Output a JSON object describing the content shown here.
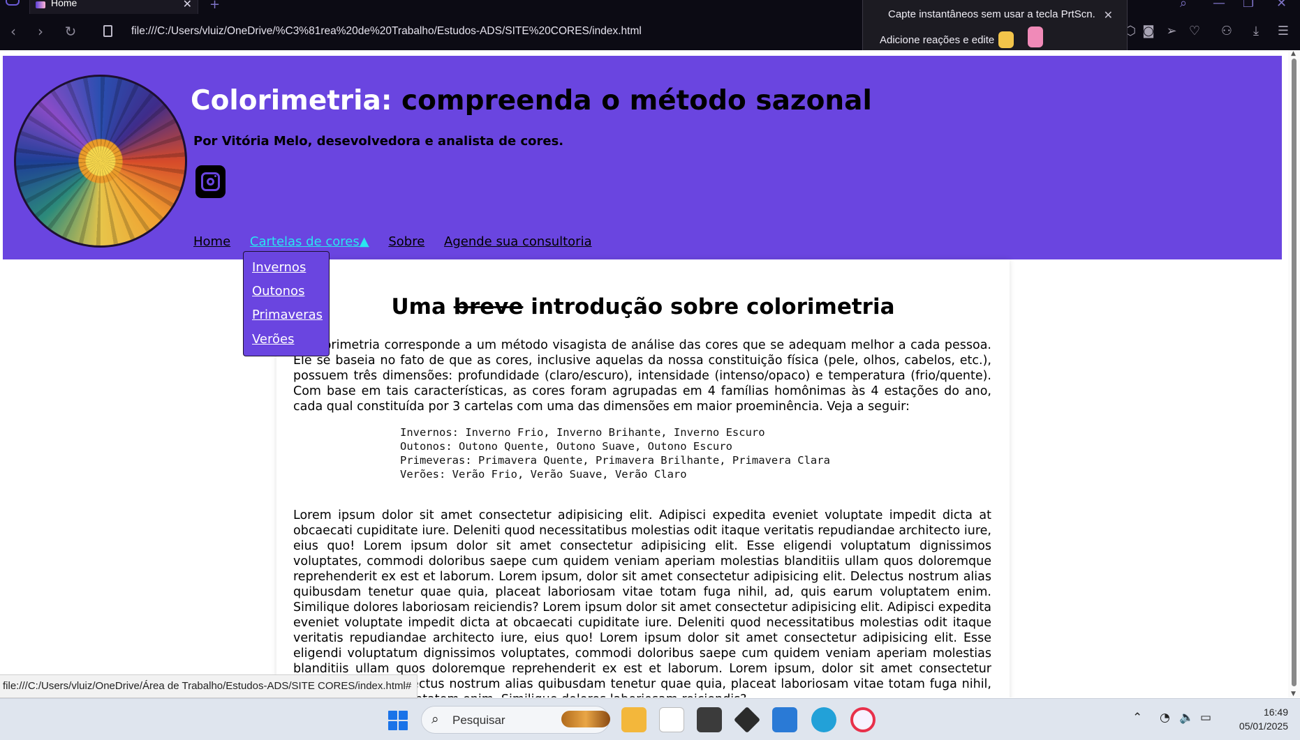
{
  "browser": {
    "tab_title": "Home",
    "url": "file:///C:/Users/vluiz/OneDrive/%C3%81rea%20de%20Trabalho/Estudos-ADS/SITE%20CORES/index.html",
    "status_link": "file:///C:/Users/vluiz/OneDrive/Área de Trabalho/Estudos-ADS/SITE CORES/index.html#"
  },
  "toast": {
    "line1": "Capte instantâneos sem usar a tecla PrtScn.",
    "line2": "Adicione reações e edite"
  },
  "site": {
    "title_white": "Colorimetria: ",
    "title_black": "compreenda o método sazonal",
    "byline": "Por Vitória Melo, desevolvedora e analista de cores.",
    "nav": [
      {
        "label": "Home"
      },
      {
        "label": "Cartelas de cores▲"
      },
      {
        "label": "Sobre"
      },
      {
        "label": "Agende sua consultoria"
      }
    ],
    "dropdown": [
      {
        "label": "Invernos"
      },
      {
        "label": "Outonos"
      },
      {
        "label": "Primaveras"
      },
      {
        "label": "Verões"
      }
    ],
    "article": {
      "heading_pre": "Uma ",
      "heading_strike": "breve",
      "heading_post": " introdução sobre colorimetria",
      "intro": "A colorimetria corresponde a um método visagista de análise das cores que se adequam melhor a cada pessoa. Ele se baseia no fato de que as cores, inclusive aquelas da nossa constituição física (pele, olhos, cabelos, etc.), possuem três dimensões: profundidade (claro/escuro), intensidade (intenso/opaco) e temperatura (frio/quente). Com base em tais características, as cores foram agrupadas em 4 famílias homônimas às 4 estações do ano, cada qual constituída por 3 cartelas com uma das dimensões em maior proeminência. Veja a seguir:",
      "list": [
        "Invernos: Inverno Frio, Inverno Brihante, Inverno Escuro",
        "Outonos: Outono Quente, Outono Suave, Outono Escuro",
        "Primeveras: Primavera Quente, Primavera Brilhante, Primavera Clara",
        "Verões: Verão Frio, Verão Suave, Verão Claro"
      ],
      "lorem": "Lorem ipsum dolor sit amet consectetur adipisicing elit. Adipisci expedita eveniet voluptate impedit dicta at obcaecati cupiditate iure. Deleniti quod necessitatibus molestias odit itaque veritatis repudiandae architecto iure, eius quo! Lorem ipsum dolor sit amet consectetur adipisicing elit. Esse eligendi voluptatum dignissimos voluptates, commodi doloribus saepe cum quidem veniam aperiam molestias blanditiis ullam quos doloremque reprehenderit ex est et laborum. Lorem ipsum, dolor sit amet consectetur adipisicing elit. Delectus nostrum alias quibusdam tenetur quae quia, placeat laboriosam vitae totam fuga nihil, ad, quis earum voluptatem enim. Similique dolores laboriosam reiciendis? Lorem ipsum dolor sit amet consectetur adipisicing elit. Adipisci expedita eveniet voluptate impedit dicta at obcaecati cupiditate iure. Deleniti quod necessitatibus molestias odit itaque veritatis repudiandae architecto iure, eius quo! Lorem ipsum dolor sit amet consectetur adipisicing elit. Esse eligendi voluptatum dignissimos voluptates, commodi doloribus saepe cum quidem veniam aperiam molestias blanditiis ullam quos doloremque reprehenderit ex est et laborum. Lorem ipsum, dolor sit amet consectetur adipisicing elit. Delectus nostrum alias quibusdam tenetur quae quia, placeat laboriosam vitae totam fuga nihil, ad, quis earum voluptatem enim. Similique dolores laboriosam reiciendis?"
    }
  },
  "taskbar": {
    "search_placeholder": "Pesquisar",
    "time": "16:49",
    "date": "05/01/2025"
  },
  "colors": {
    "header_bg": "#6a45e0",
    "nav_active": "#29e6f0",
    "chrome_bg": "#0c0b14"
  }
}
